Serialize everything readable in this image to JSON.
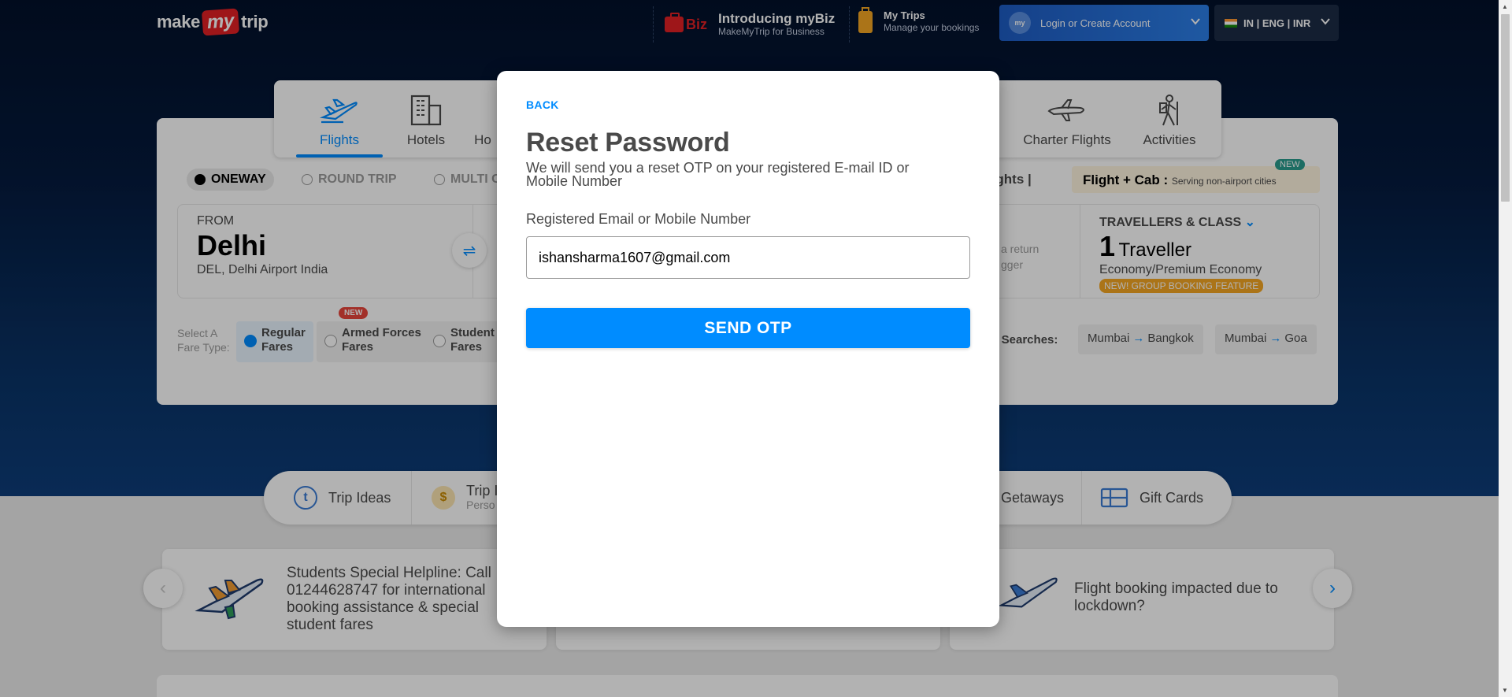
{
  "header": {
    "logo": {
      "make": "make",
      "my": "my",
      "trip": "trip"
    },
    "mybiz": {
      "badge": "Biz",
      "title": "Introducing myBiz",
      "subtitle": "MakeMyTrip for Business"
    },
    "mytrips": {
      "title": "My Trips",
      "subtitle": "Manage your bookings"
    },
    "login": {
      "avatar": "my",
      "label": "Login or Create Account"
    },
    "locale": "IN | ENG | INR"
  },
  "tabs": [
    {
      "label": "Flights",
      "icon": "plane-icon"
    },
    {
      "label": "Hotels",
      "icon": "building-icon"
    },
    {
      "label": "Ho",
      "icon": "homestay-icon"
    },
    {
      "label": "Charter Flights",
      "icon": "charter-plane-icon"
    },
    {
      "label": "Activities",
      "icon": "hiker-icon"
    }
  ],
  "trip_types": {
    "oneway": "ONEWAY",
    "round": "ROUND TRIP",
    "multi": "MULTI C"
  },
  "domestic": "tic Flights |",
  "flight_cab": {
    "title": "Flight + Cab :",
    "note": "Serving non-airport cities",
    "badge": "NEW"
  },
  "from": {
    "label": "FROM",
    "city": "Delhi",
    "airport": "DEL, Delhi Airport India"
  },
  "return_hint": {
    "line1": "a return",
    "line2": "gger"
  },
  "travellers": {
    "label": "TRAVELLERS & CLASS",
    "count": "1",
    "unit": "Traveller",
    "class": "Economy/Premium Economy",
    "badge": "NEW! GROUP BOOKING FEATURE"
  },
  "fare": {
    "label_line1": "Select A",
    "label_line2": "Fare Type:",
    "new_badge": "NEW",
    "options": [
      {
        "line1": "Regular",
        "line2": "Fares"
      },
      {
        "line1": "Armed Forces",
        "line2": "Fares"
      },
      {
        "line1": "Student",
        "line2": "Fares"
      }
    ]
  },
  "trending": {
    "label": "ing Searches:",
    "chips": [
      {
        "from": "Mumbai",
        "to": "Bangkok"
      },
      {
        "from": "Mumbai",
        "to": "Goa"
      }
    ]
  },
  "quick_links": [
    {
      "label": "Trip Ideas",
      "icon": "compass-icon"
    },
    {
      "label": "Trip I",
      "sub": "Perso",
      "icon": "money-bag-icon"
    },
    {
      "label": "Getaways",
      "icon": "beach-icon"
    },
    {
      "label": "Gift Cards",
      "icon": "gift-card-icon"
    }
  ],
  "promos": [
    {
      "text": "Students Special Helpline: Call 01244628747 for international booking assistance & special student fares"
    },
    {
      "text": "Flight booking impacted due to lockdown?"
    }
  ],
  "modal": {
    "back": "BACK",
    "title": "Reset Password",
    "subtitle": "We will send you a reset OTP on your registered E-mail ID or Mobile Number",
    "field_label": "Registered Email or Mobile Number",
    "field_value": "ishansharma1607@gmail.com",
    "submit": "SEND OTP"
  },
  "colors": {
    "accent": "#008cff",
    "brand_red": "#e32025",
    "login_blue": "#1e5cc4"
  }
}
